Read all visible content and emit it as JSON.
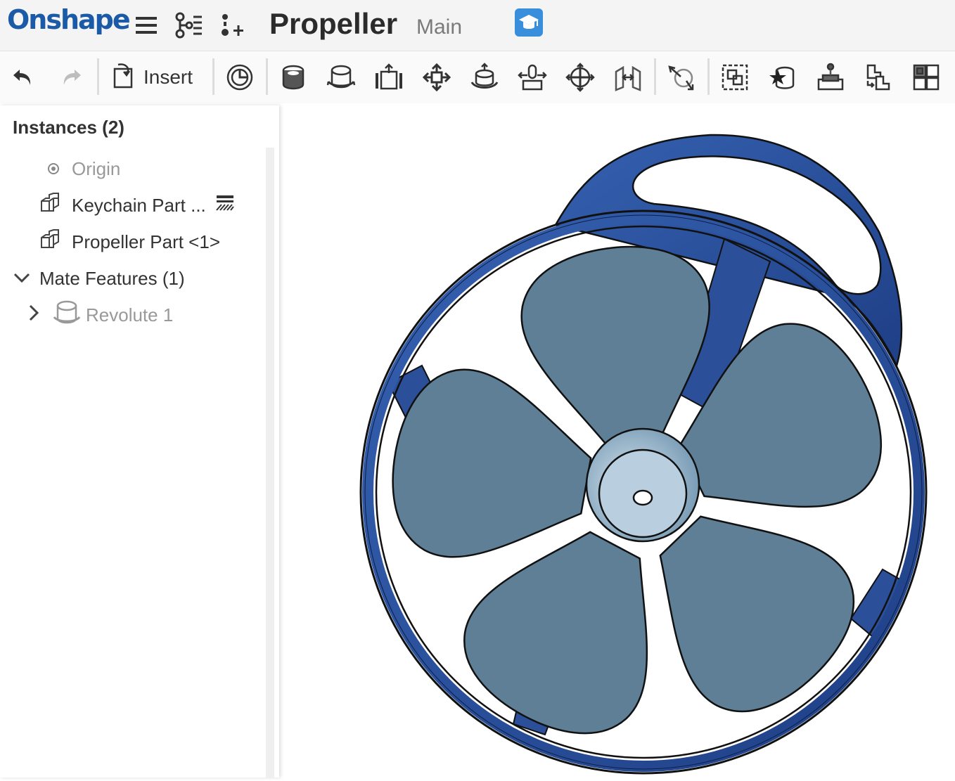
{
  "header": {
    "logo": "Onshape",
    "document_title": "Propeller",
    "branch": "Main",
    "icons": [
      "menu-icon",
      "feature-tree-icon",
      "insert-mate-icon",
      "education-badge-icon"
    ]
  },
  "toolbar": {
    "insert_label": "Insert",
    "icons": [
      "undo-icon",
      "redo-icon",
      "insert-icon",
      "mate-connector-icon",
      "fastened-mate-icon",
      "revolute-mate-icon",
      "slider-mate-icon",
      "planar-mate-icon",
      "cylindrical-mate-icon",
      "pin-slot-mate-icon",
      "ball-mate-icon",
      "parallel-mate-icon",
      "tangent-mate-icon",
      "group-icon",
      "replicate-icon",
      "fit-icon",
      "pattern-icon",
      "explode-icon"
    ]
  },
  "panel": {
    "title": "Instances (2)",
    "items": [
      {
        "label": "Origin",
        "icon": "origin-icon"
      },
      {
        "label": "Keychain Part ...",
        "icon": "part-icon"
      },
      {
        "label": "Propeller Part <1>",
        "icon": "part-icon"
      },
      {
        "label": "Mate Features (1)",
        "icon": "chevron-down-icon"
      },
      {
        "label": "Revolute 1",
        "icon": "revolute-mate-icon"
      }
    ]
  },
  "colors": {
    "brand": "#1b5aa6",
    "ring": "#2f55a0",
    "blade": "#8fb1c9",
    "edu_badge": "#3a8fdc"
  }
}
